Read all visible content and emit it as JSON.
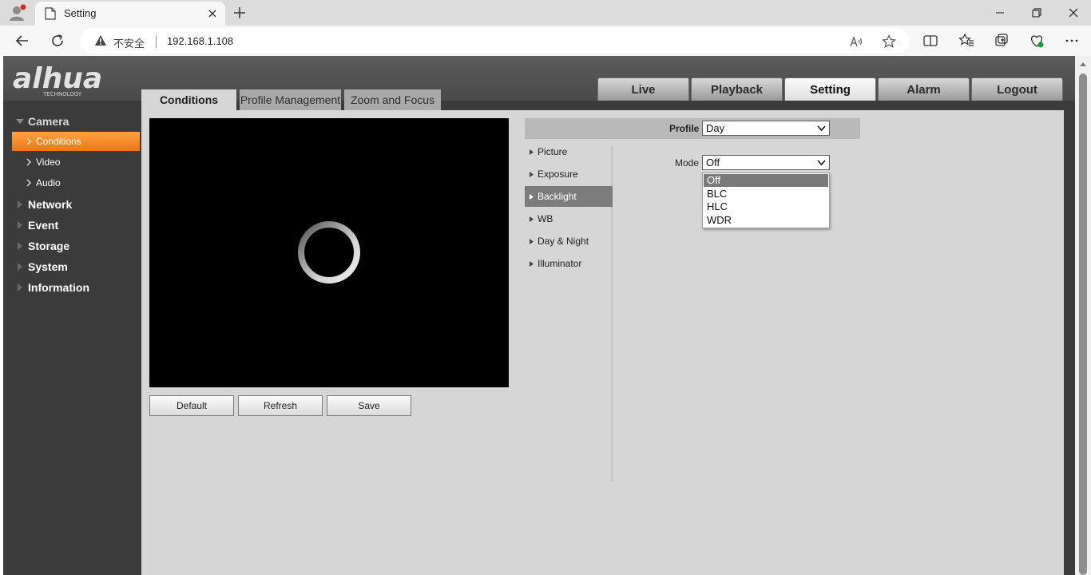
{
  "browser": {
    "tab_title": "Setting",
    "insecure_label": "不安全",
    "url": "192.168.1.108"
  },
  "app": {
    "top_tabs": [
      {
        "label": "Live",
        "active": false
      },
      {
        "label": "Playback",
        "active": false
      },
      {
        "label": "Setting",
        "active": true
      },
      {
        "label": "Alarm",
        "active": false
      },
      {
        "label": "Logout",
        "active": false
      }
    ],
    "sidebar": {
      "groups": [
        {
          "label": "Camera",
          "open": true
        },
        {
          "label": "Network"
        },
        {
          "label": "Event"
        },
        {
          "label": "Storage"
        },
        {
          "label": "System"
        },
        {
          "label": "Information"
        }
      ],
      "camera_items": [
        {
          "label": "Conditions",
          "active": true
        },
        {
          "label": "Video"
        },
        {
          "label": "Audio"
        }
      ]
    },
    "sub_tabs": [
      {
        "label": "Conditions",
        "active": true
      },
      {
        "label": "Profile Management"
      },
      {
        "label": "Zoom and Focus"
      }
    ],
    "buttons": {
      "default": "Default",
      "refresh": "Refresh",
      "save": "Save"
    },
    "profile": {
      "label": "Profile",
      "value": "Day"
    },
    "menu": [
      {
        "label": "Picture"
      },
      {
        "label": "Exposure"
      },
      {
        "label": "Backlight",
        "active": true
      },
      {
        "label": "WB"
      },
      {
        "label": "Day & Night"
      },
      {
        "label": "Illuminator"
      }
    ],
    "mode": {
      "label": "Mode",
      "value": "Off",
      "options": [
        "Off",
        "BLC",
        "HLC",
        "WDR"
      ],
      "highlighted": "Off"
    }
  },
  "colors": {
    "accent": "#f07810",
    "active_menu": "#7c7c7c",
    "header": "#4a4a4a",
    "content_bg": "#d6d6d6"
  },
  "icons": {
    "sidebar_collapsed": "triangle-right-icon",
    "sidebar_expanded": "triangle-down-icon",
    "sub_item": "chevron-right-icon",
    "menu_item": "triangle-right-icon"
  }
}
